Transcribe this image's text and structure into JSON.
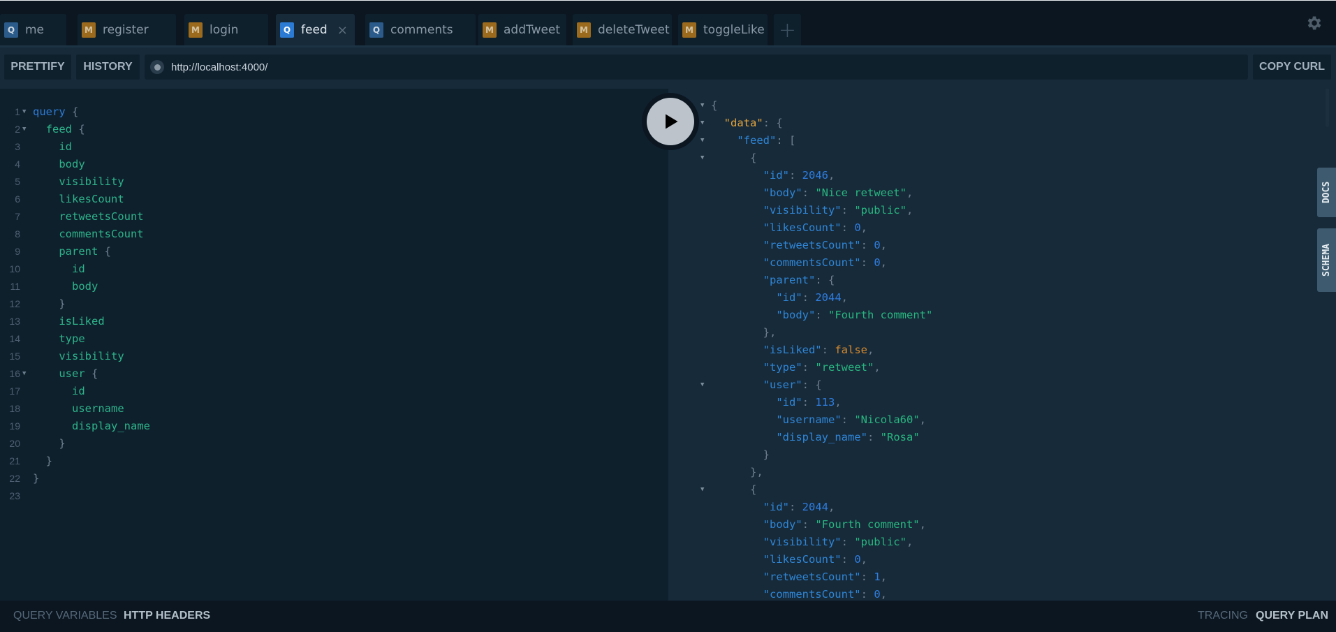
{
  "tabs": [
    {
      "badge": "Q",
      "label": "me",
      "active": false
    },
    {
      "badge": "M",
      "label": "register",
      "active": false
    },
    {
      "badge": "M",
      "label": "login",
      "active": false
    },
    {
      "badge": "Q",
      "label": "feed",
      "active": true,
      "close": "×"
    },
    {
      "badge": "Q",
      "label": "comments",
      "active": false
    },
    {
      "badge": "M",
      "label": "addTweet",
      "active": false
    },
    {
      "badge": "M",
      "label": "deleteTweet",
      "active": false
    },
    {
      "badge": "M",
      "label": "toggleLike",
      "active": false
    }
  ],
  "add_tab_label": "+",
  "toolbar": {
    "prettify": "PRETTIFY",
    "history": "HISTORY",
    "url": "http://localhost:4000/",
    "copy_curl": "COPY CURL"
  },
  "editor": {
    "lines": [
      {
        "n": "1",
        "fold": true,
        "indent": "",
        "parts": [
          [
            "kw",
            "query"
          ],
          [
            "pun",
            " {"
          ]
        ]
      },
      {
        "n": "2",
        "fold": true,
        "indent": "  ",
        "parts": [
          [
            "fld",
            "feed"
          ],
          [
            "pun",
            " {"
          ]
        ]
      },
      {
        "n": "3",
        "indent": "    ",
        "parts": [
          [
            "fld",
            "id"
          ]
        ]
      },
      {
        "n": "4",
        "indent": "    ",
        "parts": [
          [
            "fld",
            "body"
          ]
        ]
      },
      {
        "n": "5",
        "indent": "    ",
        "parts": [
          [
            "fld",
            "visibility"
          ]
        ]
      },
      {
        "n": "6",
        "indent": "    ",
        "parts": [
          [
            "fld",
            "likesCount"
          ]
        ]
      },
      {
        "n": "7",
        "indent": "    ",
        "parts": [
          [
            "fld",
            "retweetsCount"
          ]
        ]
      },
      {
        "n": "8",
        "indent": "    ",
        "parts": [
          [
            "fld",
            "commentsCount"
          ]
        ]
      },
      {
        "n": "9",
        "indent": "    ",
        "parts": [
          [
            "fld",
            "parent"
          ],
          [
            "pun",
            " {"
          ]
        ]
      },
      {
        "n": "10",
        "indent": "      ",
        "parts": [
          [
            "fld",
            "id"
          ]
        ]
      },
      {
        "n": "11",
        "indent": "      ",
        "parts": [
          [
            "fld",
            "body"
          ]
        ]
      },
      {
        "n": "12",
        "indent": "    ",
        "parts": [
          [
            "pun",
            "}"
          ]
        ]
      },
      {
        "n": "13",
        "indent": "    ",
        "parts": [
          [
            "fld",
            "isLiked"
          ]
        ]
      },
      {
        "n": "14",
        "indent": "    ",
        "parts": [
          [
            "fld",
            "type"
          ]
        ]
      },
      {
        "n": "15",
        "indent": "    ",
        "parts": [
          [
            "fld",
            "visibility"
          ]
        ]
      },
      {
        "n": "16",
        "fold": true,
        "indent": "    ",
        "parts": [
          [
            "fld",
            "user"
          ],
          [
            "pun",
            " {"
          ]
        ]
      },
      {
        "n": "17",
        "indent": "      ",
        "parts": [
          [
            "fld",
            "id"
          ]
        ]
      },
      {
        "n": "18",
        "indent": "      ",
        "parts": [
          [
            "fld",
            "username"
          ]
        ]
      },
      {
        "n": "19",
        "indent": "      ",
        "parts": [
          [
            "fld",
            "display_name"
          ]
        ]
      },
      {
        "n": "20",
        "indent": "    ",
        "parts": [
          [
            "pun",
            "}"
          ]
        ]
      },
      {
        "n": "21",
        "indent": "  ",
        "parts": [
          [
            "pun",
            "}"
          ]
        ]
      },
      {
        "n": "22",
        "indent": "",
        "parts": [
          [
            "pun",
            "}"
          ]
        ]
      },
      {
        "n": "23",
        "indent": "",
        "parts": []
      }
    ]
  },
  "result": {
    "lines": [
      {
        "fold": true,
        "indent": "",
        "parts": [
          [
            "pun",
            "{"
          ]
        ]
      },
      {
        "fold": true,
        "indent": "  ",
        "parts": [
          [
            "dkey",
            "\"data\""
          ],
          [
            "pun",
            ": {"
          ]
        ]
      },
      {
        "fold": true,
        "indent": "    ",
        "parts": [
          [
            "key",
            "\"feed\""
          ],
          [
            "pun",
            ": ["
          ]
        ]
      },
      {
        "fold": true,
        "indent": "      ",
        "parts": [
          [
            "pun",
            "{"
          ]
        ]
      },
      {
        "indent": "        ",
        "parts": [
          [
            "key",
            "\"id\""
          ],
          [
            "pun",
            ": "
          ],
          [
            "num",
            "2046"
          ],
          [
            "pun",
            ","
          ]
        ]
      },
      {
        "indent": "        ",
        "parts": [
          [
            "key",
            "\"body\""
          ],
          [
            "pun",
            ": "
          ],
          [
            "str",
            "\"Nice retweet\""
          ],
          [
            "pun",
            ","
          ]
        ]
      },
      {
        "indent": "        ",
        "parts": [
          [
            "key",
            "\"visibility\""
          ],
          [
            "pun",
            ": "
          ],
          [
            "str",
            "\"public\""
          ],
          [
            "pun",
            ","
          ]
        ]
      },
      {
        "indent": "        ",
        "parts": [
          [
            "key",
            "\"likesCount\""
          ],
          [
            "pun",
            ": "
          ],
          [
            "num",
            "0"
          ],
          [
            "pun",
            ","
          ]
        ]
      },
      {
        "indent": "        ",
        "parts": [
          [
            "key",
            "\"retweetsCount\""
          ],
          [
            "pun",
            ": "
          ],
          [
            "num",
            "0"
          ],
          [
            "pun",
            ","
          ]
        ]
      },
      {
        "indent": "        ",
        "parts": [
          [
            "key",
            "\"commentsCount\""
          ],
          [
            "pun",
            ": "
          ],
          [
            "num",
            "0"
          ],
          [
            "pun",
            ","
          ]
        ]
      },
      {
        "indent": "        ",
        "parts": [
          [
            "key",
            "\"parent\""
          ],
          [
            "pun",
            ": {"
          ]
        ]
      },
      {
        "indent": "          ",
        "parts": [
          [
            "key",
            "\"id\""
          ],
          [
            "pun",
            ": "
          ],
          [
            "num",
            "2044"
          ],
          [
            "pun",
            ","
          ]
        ]
      },
      {
        "indent": "          ",
        "parts": [
          [
            "key",
            "\"body\""
          ],
          [
            "pun",
            ": "
          ],
          [
            "str",
            "\"Fourth comment\""
          ]
        ]
      },
      {
        "indent": "        ",
        "parts": [
          [
            "pun",
            "},"
          ]
        ]
      },
      {
        "indent": "        ",
        "parts": [
          [
            "key",
            "\"isLiked\""
          ],
          [
            "pun",
            ": "
          ],
          [
            "bool",
            "false"
          ],
          [
            "pun",
            ","
          ]
        ]
      },
      {
        "indent": "        ",
        "parts": [
          [
            "key",
            "\"type\""
          ],
          [
            "pun",
            ": "
          ],
          [
            "str",
            "\"retweet\""
          ],
          [
            "pun",
            ","
          ]
        ]
      },
      {
        "fold": true,
        "indent": "        ",
        "parts": [
          [
            "key",
            "\"user\""
          ],
          [
            "pun",
            ": {"
          ]
        ]
      },
      {
        "indent": "          ",
        "parts": [
          [
            "key",
            "\"id\""
          ],
          [
            "pun",
            ": "
          ],
          [
            "num",
            "113"
          ],
          [
            "pun",
            ","
          ]
        ]
      },
      {
        "indent": "          ",
        "parts": [
          [
            "key",
            "\"username\""
          ],
          [
            "pun",
            ": "
          ],
          [
            "str",
            "\"Nicola60\""
          ],
          [
            "pun",
            ","
          ]
        ]
      },
      {
        "indent": "          ",
        "parts": [
          [
            "key",
            "\"display_name\""
          ],
          [
            "pun",
            ": "
          ],
          [
            "str",
            "\"Rosa\""
          ]
        ]
      },
      {
        "indent": "        ",
        "parts": [
          [
            "pun",
            "}"
          ]
        ]
      },
      {
        "indent": "      ",
        "parts": [
          [
            "pun",
            "},"
          ]
        ]
      },
      {
        "fold": true,
        "indent": "      ",
        "parts": [
          [
            "pun",
            "{"
          ]
        ]
      },
      {
        "indent": "        ",
        "parts": [
          [
            "key",
            "\"id\""
          ],
          [
            "pun",
            ": "
          ],
          [
            "num",
            "2044"
          ],
          [
            "pun",
            ","
          ]
        ]
      },
      {
        "indent": "        ",
        "parts": [
          [
            "key",
            "\"body\""
          ],
          [
            "pun",
            ": "
          ],
          [
            "str",
            "\"Fourth comment\""
          ],
          [
            "pun",
            ","
          ]
        ]
      },
      {
        "indent": "        ",
        "parts": [
          [
            "key",
            "\"visibility\""
          ],
          [
            "pun",
            ": "
          ],
          [
            "str",
            "\"public\""
          ],
          [
            "pun",
            ","
          ]
        ]
      },
      {
        "indent": "        ",
        "parts": [
          [
            "key",
            "\"likesCount\""
          ],
          [
            "pun",
            ": "
          ],
          [
            "num",
            "0"
          ],
          [
            "pun",
            ","
          ]
        ]
      },
      {
        "indent": "        ",
        "parts": [
          [
            "key",
            "\"retweetsCount\""
          ],
          [
            "pun",
            ": "
          ],
          [
            "num",
            "1"
          ],
          [
            "pun",
            ","
          ]
        ]
      },
      {
        "indent": "        ",
        "parts": [
          [
            "key",
            "\"commentsCount\""
          ],
          [
            "pun",
            ": "
          ],
          [
            "num",
            "0"
          ],
          [
            "pun",
            ","
          ]
        ]
      }
    ]
  },
  "side_tabs": {
    "docs": "DOCS",
    "schema": "SCHEMA"
  },
  "bottom": {
    "query_variables": "QUERY VARIABLES",
    "http_headers": "HTTP HEADERS",
    "tracing": "TRACING",
    "query_plan": "QUERY PLAN"
  },
  "icons": {
    "settings": "gear-icon",
    "run": "play-icon",
    "fold": "fold-arrow-icon"
  }
}
